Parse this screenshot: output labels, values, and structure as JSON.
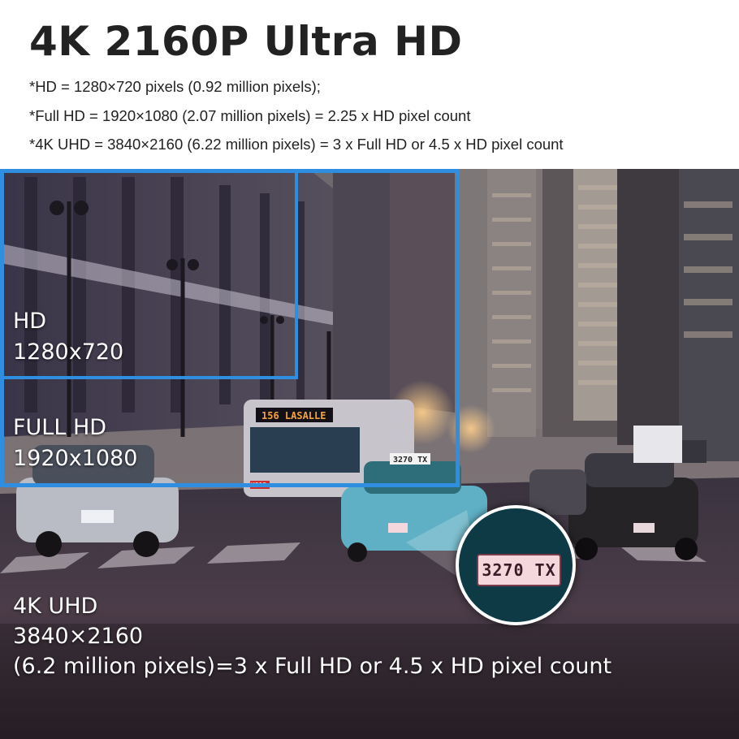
{
  "header": {
    "title": "4K 2160P Ultra HD",
    "notes": [
      "*HD = 1280×720 pixels (0.92 million pixels);",
      "*Full HD = 1920×1080 (2.07 million pixels) = 2.25 x HD pixel count",
      "*4K UHD = 3840×2160  (6.22 million pixels) = 3 x Full HD or 4.5 x HD pixel count"
    ]
  },
  "photo": {
    "bus_sign": "156  LASALLE",
    "bus_code": "K915",
    "taxi_sign": "3270 TX",
    "zoom_plate": "3270 TX"
  },
  "labels": {
    "hd": {
      "name": "HD",
      "resolution": "1280x720"
    },
    "full_hd": {
      "name": "FULL HD",
      "resolution": "1920x1080"
    },
    "uhd": {
      "name": "4K UHD",
      "resolution": "3840×2160",
      "detail": "(6.2 million pixels)=3 x Full HD or 4.5 x HD pixel count"
    }
  },
  "colors": {
    "frame": "#2f8ee0",
    "title": "#222222",
    "label_text": "#ffffff"
  }
}
